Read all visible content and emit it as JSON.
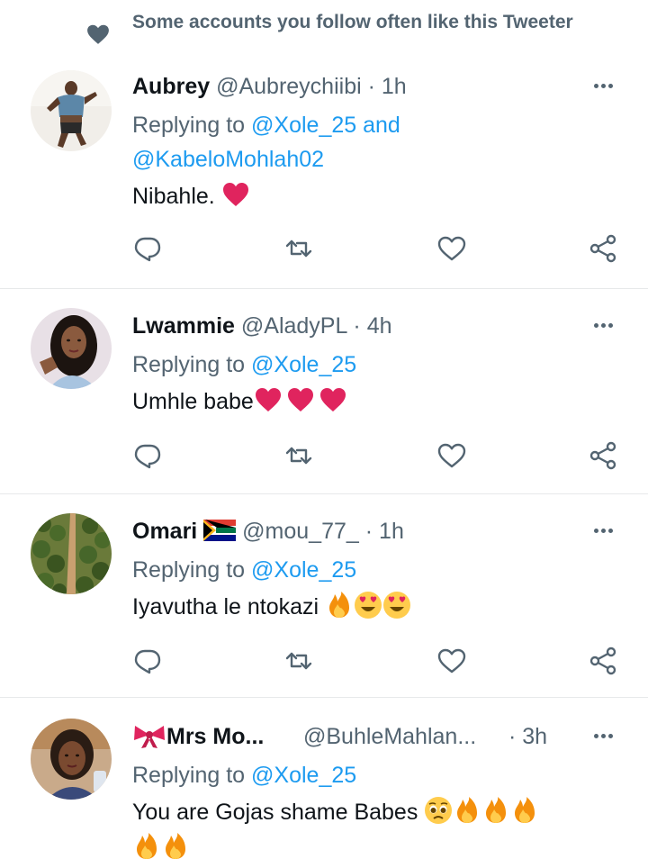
{
  "header": {
    "text": "Some accounts you follow often like this Tweeter"
  },
  "tweets": [
    {
      "name": "Aubrey",
      "handle": "@Aubreychiibi",
      "sep": "·",
      "time": "1h",
      "reply_prefix": "Replying to",
      "reply_to_1": "@Xole_25",
      "reply_and": "and",
      "reply_to_2": "@KabeloMohlah02",
      "text": "Nibahle.",
      "emojis": [
        "red-heart"
      ]
    },
    {
      "name": "Lwammie",
      "handle": "@AladyPL",
      "sep": "·",
      "time": "4h",
      "reply_prefix": "Replying to",
      "reply_to_1": "@Xole_25",
      "text": "Umhle babe",
      "emojis": [
        "red-heart",
        "red-heart",
        "red-heart"
      ]
    },
    {
      "name": "Omari",
      "flag": "south-africa-flag",
      "handle": "@mou_77_",
      "sep": "·",
      "time": "1h",
      "reply_prefix": "Replying to",
      "reply_to_1": "@Xole_25",
      "text": "Iyavutha le ntokazi",
      "emojis": [
        "fire",
        "heart-eyes",
        "heart-eyes"
      ]
    },
    {
      "name": "Mrs Mo...",
      "name_prefix_icon": "ribbon-bow",
      "handle": "@BuhleMahlan...",
      "sep": "·",
      "time": "3h",
      "reply_prefix": "Replying to",
      "reply_to_1": "@Xole_25",
      "text": "You are Gojas shame Babes",
      "emojis": [
        "pleading-face",
        "fire",
        "fire",
        "fire",
        "fire",
        "fire"
      ]
    }
  ],
  "icons": {
    "reply": "reply-icon",
    "retweet": "retweet-icon",
    "like": "like-icon",
    "share": "share-icon",
    "more": "more-icon"
  },
  "colors": {
    "link": "#1d9bf0",
    "secondary": "#536471",
    "primary_text": "#0f1419",
    "heart": "#e0245e"
  }
}
